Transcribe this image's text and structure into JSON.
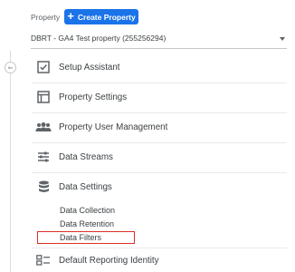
{
  "header": {
    "property_label": "Property",
    "create_button_label": "Create Property",
    "selected_property": "DBRT - GA4 Test property (255256294)"
  },
  "nav": {
    "items": [
      {
        "label": "Setup Assistant",
        "icon": "checklist-icon"
      },
      {
        "label": "Property Settings",
        "icon": "property-settings-icon"
      },
      {
        "label": "Property User Management",
        "icon": "users-icon"
      },
      {
        "label": "Data Streams",
        "icon": "data-streams-icon"
      },
      {
        "label": "Data Settings",
        "icon": "database-icon"
      }
    ],
    "sub_items": [
      "Data Collection",
      "Data Retention",
      "Data Filters"
    ],
    "bottom_item": {
      "label": "Default Reporting Identity",
      "icon": "reporting-identity-icon"
    }
  },
  "highlight_color": "#d93025",
  "accent_color": "#1a73e8"
}
